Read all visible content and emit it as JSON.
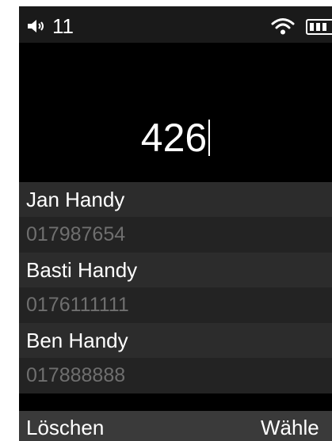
{
  "status_bar": {
    "volume_level": "11",
    "icons": [
      "speaker-icon",
      "wifi-icon",
      "battery-icon"
    ]
  },
  "dial": {
    "number": "426"
  },
  "contacts": [
    {
      "name": "Jan Handy",
      "number": "017987654"
    },
    {
      "name": "Basti Handy",
      "number": "0176111111"
    },
    {
      "name": "Ben Handy",
      "number": "017888888"
    }
  ],
  "softkeys": {
    "left": "Löschen",
    "right": "Wähle"
  },
  "colors": {
    "background": "#000000",
    "status_bar": "#1a1a1a",
    "contact_name_row": "#2c2c2c",
    "contact_number_row": "#232323",
    "contact_number_text": "#6f6f6f",
    "softkey_bar": "#3a3a3a",
    "text": "#ffffff"
  }
}
